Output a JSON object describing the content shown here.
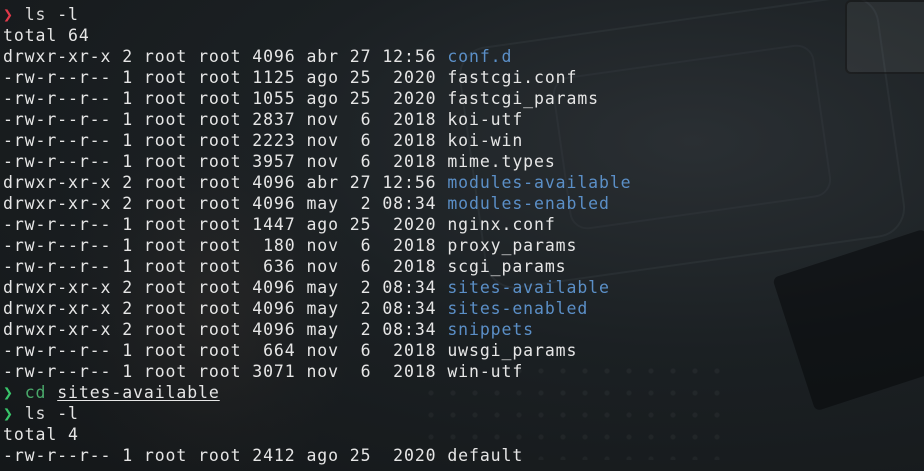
{
  "terminal": {
    "sessions": [
      {
        "prompt_symbol": "❯",
        "prompt_state": "error",
        "command": "ls",
        "args": "-l",
        "output": {
          "total": "total 64",
          "entries": [
            {
              "perms": "drwxr-xr-x",
              "links": "2",
              "owner": "root",
              "group": "root",
              "size": "4096",
              "month": "abr",
              "day": "27",
              "time": "12:56",
              "name": "conf.d",
              "type": "dir"
            },
            {
              "perms": "-rw-r--r--",
              "links": "1",
              "owner": "root",
              "group": "root",
              "size": "1125",
              "month": "ago",
              "day": "25",
              "time": " 2020",
              "name": "fastcgi.conf",
              "type": "file"
            },
            {
              "perms": "-rw-r--r--",
              "links": "1",
              "owner": "root",
              "group": "root",
              "size": "1055",
              "month": "ago",
              "day": "25",
              "time": " 2020",
              "name": "fastcgi_params",
              "type": "file"
            },
            {
              "perms": "-rw-r--r--",
              "links": "1",
              "owner": "root",
              "group": "root",
              "size": "2837",
              "month": "nov",
              "day": " 6",
              "time": " 2018",
              "name": "koi-utf",
              "type": "file"
            },
            {
              "perms": "-rw-r--r--",
              "links": "1",
              "owner": "root",
              "group": "root",
              "size": "2223",
              "month": "nov",
              "day": " 6",
              "time": " 2018",
              "name": "koi-win",
              "type": "file"
            },
            {
              "perms": "-rw-r--r--",
              "links": "1",
              "owner": "root",
              "group": "root",
              "size": "3957",
              "month": "nov",
              "day": " 6",
              "time": " 2018",
              "name": "mime.types",
              "type": "file"
            },
            {
              "perms": "drwxr-xr-x",
              "links": "2",
              "owner": "root",
              "group": "root",
              "size": "4096",
              "month": "abr",
              "day": "27",
              "time": "12:56",
              "name": "modules-available",
              "type": "dir"
            },
            {
              "perms": "drwxr-xr-x",
              "links": "2",
              "owner": "root",
              "group": "root",
              "size": "4096",
              "month": "may",
              "day": " 2",
              "time": "08:34",
              "name": "modules-enabled",
              "type": "dir"
            },
            {
              "perms": "-rw-r--r--",
              "links": "1",
              "owner": "root",
              "group": "root",
              "size": "1447",
              "month": "ago",
              "day": "25",
              "time": " 2020",
              "name": "nginx.conf",
              "type": "file"
            },
            {
              "perms": "-rw-r--r--",
              "links": "1",
              "owner": "root",
              "group": "root",
              "size": " 180",
              "month": "nov",
              "day": " 6",
              "time": " 2018",
              "name": "proxy_params",
              "type": "file"
            },
            {
              "perms": "-rw-r--r--",
              "links": "1",
              "owner": "root",
              "group": "root",
              "size": " 636",
              "month": "nov",
              "day": " 6",
              "time": " 2018",
              "name": "scgi_params",
              "type": "file"
            },
            {
              "perms": "drwxr-xr-x",
              "links": "2",
              "owner": "root",
              "group": "root",
              "size": "4096",
              "month": "may",
              "day": " 2",
              "time": "08:34",
              "name": "sites-available",
              "type": "dir"
            },
            {
              "perms": "drwxr-xr-x",
              "links": "2",
              "owner": "root",
              "group": "root",
              "size": "4096",
              "month": "may",
              "day": " 2",
              "time": "08:34",
              "name": "sites-enabled",
              "type": "dir"
            },
            {
              "perms": "drwxr-xr-x",
              "links": "2",
              "owner": "root",
              "group": "root",
              "size": "4096",
              "month": "may",
              "day": " 2",
              "time": "08:34",
              "name": "snippets",
              "type": "dir"
            },
            {
              "perms": "-rw-r--r--",
              "links": "1",
              "owner": "root",
              "group": "root",
              "size": " 664",
              "month": "nov",
              "day": " 6",
              "time": " 2018",
              "name": "uwsgi_params",
              "type": "file"
            },
            {
              "perms": "-rw-r--r--",
              "links": "1",
              "owner": "root",
              "group": "root",
              "size": "3071",
              "month": "nov",
              "day": " 6",
              "time": " 2018",
              "name": "win-utf",
              "type": "file"
            }
          ]
        }
      },
      {
        "prompt_symbol": "❯",
        "prompt_state": "ok",
        "command": "cd",
        "args": "sites-available",
        "output": null
      },
      {
        "prompt_symbol": "❯",
        "prompt_state": "ok",
        "command": "ls",
        "args": "-l",
        "output": {
          "total": "total 4",
          "entries": [
            {
              "perms": "-rw-r--r--",
              "links": "1",
              "owner": "root",
              "group": "root",
              "size": "2412",
              "month": "ago",
              "day": "25",
              "time": " 2020",
              "name": "default",
              "type": "file"
            }
          ]
        }
      }
    ],
    "colors": {
      "background": "#1b2023",
      "text": "#e6e6e6",
      "directory": "#5b8fc7",
      "prompt_error": "#e0394a",
      "prompt_ok": "#39c46a"
    }
  }
}
